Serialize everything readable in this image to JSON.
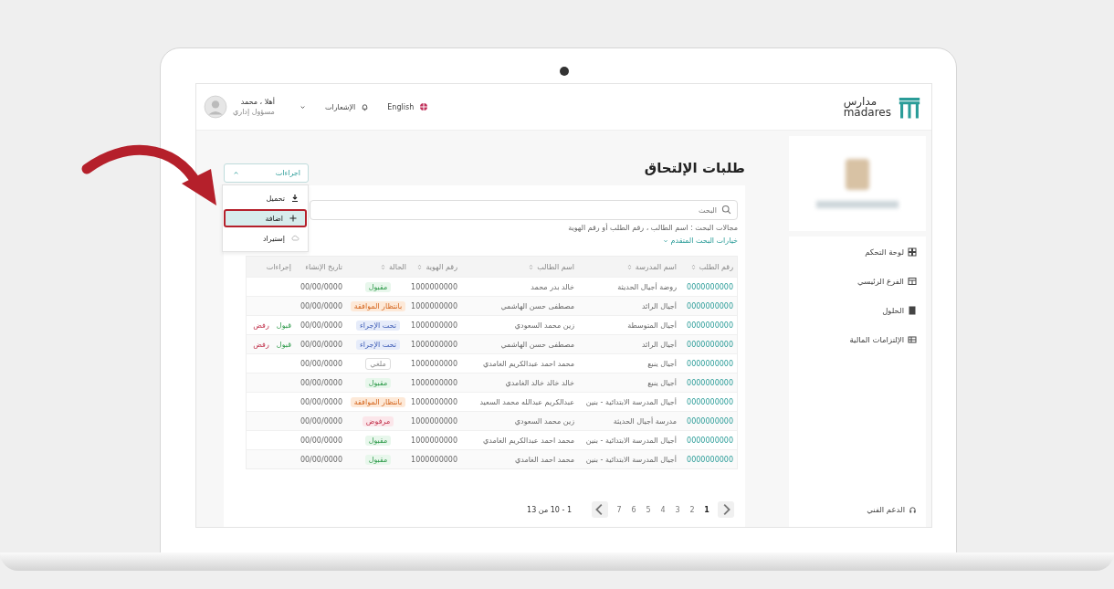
{
  "header": {
    "logo_arabic": "مدارس",
    "logo_latin": "madares",
    "language_label": "English",
    "notifications_label": "الإشعارات",
    "user_name": "أهلا ، محمد",
    "user_role": "مسؤول إداري"
  },
  "sidebar": {
    "items": [
      {
        "label": "لوحة التحكم",
        "selected": false
      },
      {
        "label": "الفرع الرئيسي",
        "selected": false
      },
      {
        "label": "الحلول",
        "selected": false
      },
      {
        "label": "الإلتزامات المالية",
        "selected": false
      }
    ],
    "support_label": "الدعم الفني"
  },
  "page_title": "طلبات الإلتحاق",
  "actions_menu": {
    "label": "اجراءات",
    "expanded": true,
    "items": [
      {
        "label": "تحميل",
        "kind": "download",
        "highlighted": false
      },
      {
        "label": "اضافة",
        "kind": "add",
        "highlighted": true
      },
      {
        "label": "إستيراد",
        "kind": "import",
        "highlighted": false
      }
    ]
  },
  "search": {
    "placeholder": "البحث"
  },
  "search_hint": "مجالات البحث : اسم الطالب ، رقم الطلب أو رقم الهوية",
  "advanced_search_label": "خيارات البحث المتقدم",
  "table": {
    "columns": [
      "رقم الطلب",
      "اسم المدرسة",
      "اسم الطالب",
      "رقم الهوية",
      "الحالة",
      "تاريخ الإنشاء",
      "إجراءات"
    ],
    "rows": [
      {
        "request_no": "0000000000",
        "school": "روضة أجيال الحديثة",
        "student": "خالد بدر محمد",
        "national_id": "1000000000",
        "status": {
          "label": "مقبول",
          "kind": "accepted"
        },
        "created": "00/00/0000",
        "actions": []
      },
      {
        "request_no": "0000000000",
        "school": "أجيال الرائد",
        "student": "مصطفى حسن الهاشمي",
        "national_id": "1000000000",
        "status": {
          "label": "بانتظار الموافقة",
          "kind": "pending"
        },
        "created": "00/00/0000",
        "actions": []
      },
      {
        "request_no": "0000000000",
        "school": "أجيال المتوسطة",
        "student": "زين محمد السعودي",
        "national_id": "1000000000",
        "status": {
          "label": "تحت الإجراء",
          "kind": "processing"
        },
        "created": "00/00/0000",
        "actions": [
          {
            "label": "قبول",
            "kind": "accept"
          },
          {
            "label": "رفض",
            "kind": "reject"
          }
        ]
      },
      {
        "request_no": "0000000000",
        "school": "أجيال الرائد",
        "student": "مصطفى حسن الهاشمي",
        "national_id": "1000000000",
        "status": {
          "label": "تحت الإجراء",
          "kind": "processing"
        },
        "created": "00/00/0000",
        "actions": [
          {
            "label": "قبول",
            "kind": "accept"
          },
          {
            "label": "رفض",
            "kind": "reject"
          }
        ]
      },
      {
        "request_no": "0000000000",
        "school": "أجيال ينبع",
        "student": "محمد احمد عبدالكريم الغامدي",
        "national_id": "1000000000",
        "status": {
          "label": "ملغي",
          "kind": "cancelled"
        },
        "created": "00/00/0000",
        "actions": []
      },
      {
        "request_no": "0000000000",
        "school": "أجيال ينبع",
        "student": "خالد خالد خالد الغامدي",
        "national_id": "1000000000",
        "status": {
          "label": "مقبول",
          "kind": "accepted"
        },
        "created": "00/00/0000",
        "actions": []
      },
      {
        "request_no": "0000000000",
        "school": "أجيال المدرسة الابتدائية - بنين",
        "student": "عبدالكريم عبدالله محمد السعيد",
        "national_id": "1000000000",
        "status": {
          "label": "بانتظار الموافقة",
          "kind": "pending"
        },
        "created": "00/00/0000",
        "actions": []
      },
      {
        "request_no": "0000000000",
        "school": "مدرسة أجيال الحديثة",
        "student": "زين محمد السعودي",
        "national_id": "1000000000",
        "status": {
          "label": "مرفوض",
          "kind": "rejected"
        },
        "created": "00/00/0000",
        "actions": []
      },
      {
        "request_no": "0000000000",
        "school": "أجيال المدرسة الابتدائية - بنين",
        "student": "محمد احمد عبدالكريم الغامدي",
        "national_id": "1000000000",
        "status": {
          "label": "مقبول",
          "kind": "accepted"
        },
        "created": "00/00/0000",
        "actions": []
      },
      {
        "request_no": "0000000000",
        "school": "أجيال المدرسة الابتدائية - بنين",
        "student": "محمد احمد الغامدي",
        "national_id": "1000000000",
        "status": {
          "label": "مقبول",
          "kind": "accepted"
        },
        "created": "00/00/0000",
        "actions": []
      }
    ]
  },
  "pagination": {
    "range_label": "1 - 10 من 13",
    "pages": [
      {
        "label": "1",
        "selected": true
      },
      {
        "label": "2",
        "selected": false
      },
      {
        "label": "3",
        "selected": false
      },
      {
        "label": "4",
        "selected": false
      },
      {
        "label": "5",
        "selected": false
      },
      {
        "label": "6",
        "selected": false
      },
      {
        "label": "7",
        "selected": false
      }
    ]
  }
}
